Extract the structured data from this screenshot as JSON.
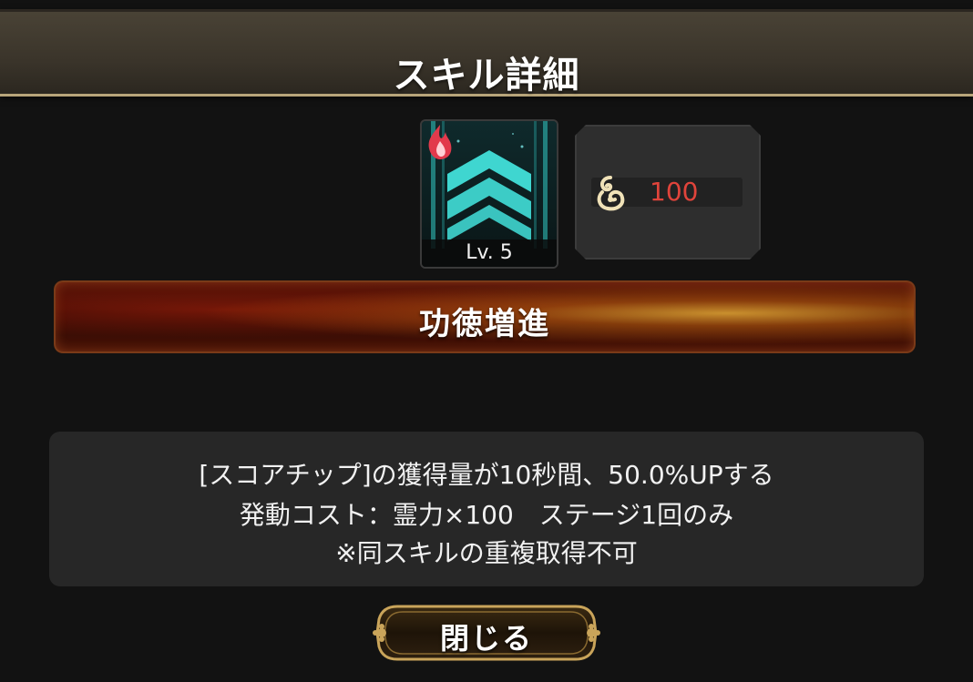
{
  "dialog": {
    "title": "スキル詳細"
  },
  "skill": {
    "level_label": "Lv. 5",
    "icon": "chevron-rank-icon",
    "element_badge": "fire-icon",
    "name": "功徳増進"
  },
  "cost": {
    "currency_icon": "spirit-icon",
    "value": "100",
    "value_color": "#e0443b"
  },
  "description": {
    "line1": "[スコアチップ]の獲得量が10秒間、50.0%UPする",
    "line2": "発動コスト：霊力×100　ステージ1回のみ",
    "line3": "※同スキルの重複取得不可"
  },
  "buttons": {
    "close_label": "閉じる"
  },
  "colors": {
    "header_accent": "#b8a57a",
    "icon_cyan": "#3fd6d0",
    "banner_orange": "#f0a030",
    "button_gold": "#c9a45a"
  }
}
